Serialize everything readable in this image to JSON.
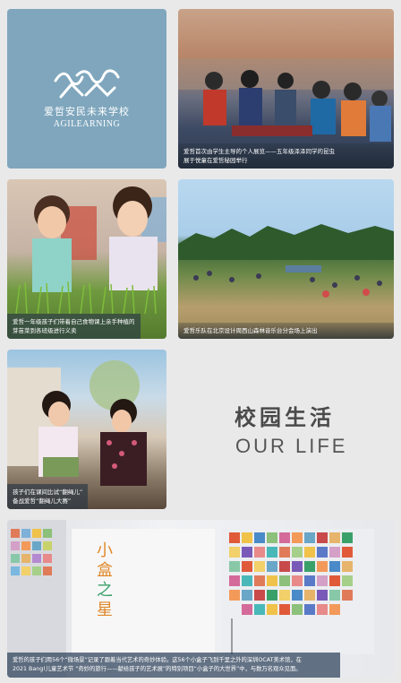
{
  "logo": {
    "name_cn": "爱哲安民未来学校",
    "name_en": "AGILEARNING",
    "colors": {
      "tile": "#7fa6bd",
      "text": "#ffffff"
    }
  },
  "photos": [
    {
      "caption": [
        "爱哲首次由学生主导的个人展览——五年级泽泽同学的昆虫",
        "展于悦童在爱哲秘园举行"
      ]
    },
    {
      "caption": [
        "爱哲一年级孩子们带着自己食物课上亲手种植的",
        "芽苗菜到各班级进行义卖"
      ]
    },
    {
      "caption": [
        "爱哲乐队在北京设计周西山森林音乐台分会场上演出"
      ]
    },
    {
      "caption": [
        "孩子们在课间比试“翻绳儿”",
        "备战爱哲“翻绳儿大赛”"
      ]
    },
    {
      "caption": [
        "爱哲的孩子们用56个“微场景”记录了跟着当代艺术的奇妙体验。这56个小盒子飞到千里之外的深圳OCAT美术馆，在",
        "2021 Bang!儿童艺术节 “奇妙的旅行——献给孩子的艺术展”的特别项目“小盒子的大世界”中，与数万名观众见面。"
      ]
    }
  ],
  "section_title": {
    "cn": "校园生活",
    "en": "OUR LIFE"
  },
  "colors": {
    "background": "#e9e9ea",
    "title": "#4a4a4a"
  }
}
